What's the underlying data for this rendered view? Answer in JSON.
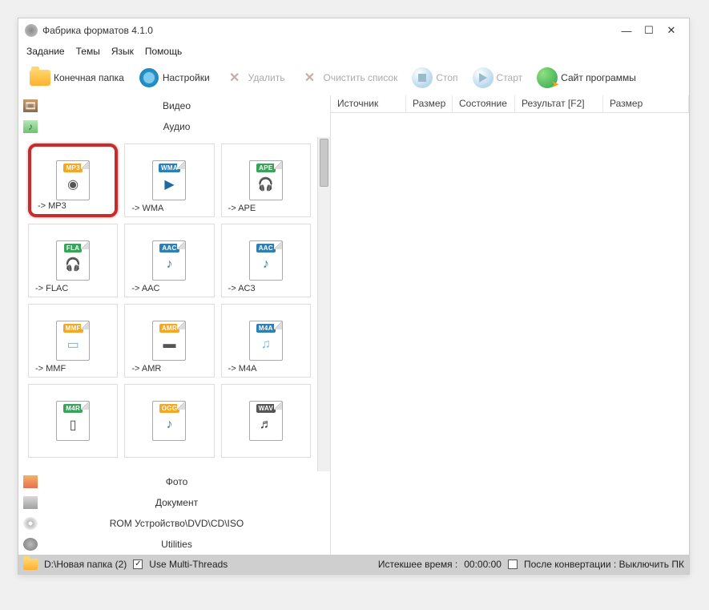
{
  "title": "Фабрика форматов 4.1.0",
  "menu": {
    "task": "Задание",
    "themes": "Темы",
    "lang": "Язык",
    "help": "Помощь"
  },
  "toolbar": {
    "output": "Конечная папка",
    "settings": "Настройки",
    "delete": "Удалить",
    "clear": "Очистить список",
    "stop": "Стоп",
    "start": "Старт",
    "site": "Сайт программы"
  },
  "categories": {
    "video": "Видео",
    "audio": "Аудио",
    "photo": "Фото",
    "document": "Документ",
    "rom": "ROM Устройство\\DVD\\CD\\ISO",
    "utilities": "Utilities"
  },
  "formats": [
    {
      "tag": "MP3",
      "tag_bg": "#f5a623",
      "label": "-> MP3",
      "glyph": "◉",
      "glyph_color": "#555"
    },
    {
      "tag": "WMA",
      "tag_bg": "#2d7fb5",
      "label": "-> WMA",
      "glyph": "▶",
      "glyph_color": "#1d6aa0"
    },
    {
      "tag": "APE",
      "tag_bg": "#3aa35a",
      "label": "-> APE",
      "glyph": "🎧",
      "glyph_color": "#e89b2f"
    },
    {
      "tag": "FLA",
      "tag_bg": "#3aa35a",
      "label": "-> FLAC",
      "glyph": "🎧",
      "glyph_color": "#555"
    },
    {
      "tag": "AAC",
      "tag_bg": "#2d7fb5",
      "label": "-> AAC",
      "glyph": "♪",
      "glyph_color": "#2d7fb5"
    },
    {
      "tag": "AAC",
      "tag_bg": "#2d7fb5",
      "label": "-> AC3",
      "glyph": "♪",
      "glyph_color": "#2d7fb5"
    },
    {
      "tag": "MMF",
      "tag_bg": "#f5a623",
      "label": "-> MMF",
      "glyph": "▭",
      "glyph_color": "#7aa9c9"
    },
    {
      "tag": "AMR",
      "tag_bg": "#f5a623",
      "label": "-> AMR",
      "glyph": "▬",
      "glyph_color": "#555"
    },
    {
      "tag": "M4A",
      "tag_bg": "#2d7fb5",
      "label": "-> M4A",
      "glyph": "♫",
      "glyph_color": "#74b9e6"
    },
    {
      "tag": "M4R",
      "tag_bg": "#3aa35a",
      "label": "",
      "glyph": "▯",
      "glyph_color": "#444"
    },
    {
      "tag": "OGG",
      "tag_bg": "#f5a623",
      "label": "",
      "glyph": "♪",
      "glyph_color": "#2d7fb5"
    },
    {
      "tag": "WAV",
      "tag_bg": "#555555",
      "label": "",
      "glyph": "♬",
      "glyph_color": "#333"
    }
  ],
  "columns": {
    "source": "Источник",
    "size1": "Размер",
    "state": "Состояние",
    "result": "Результат [F2]",
    "size2": "Размер"
  },
  "status": {
    "path": "D:\\Новая папка (2)",
    "threads": "Use Multi-Threads",
    "elapsed_label": "Истекшее время :",
    "elapsed": "00:00:00",
    "after": "После конвертации : Выключить ПК"
  }
}
